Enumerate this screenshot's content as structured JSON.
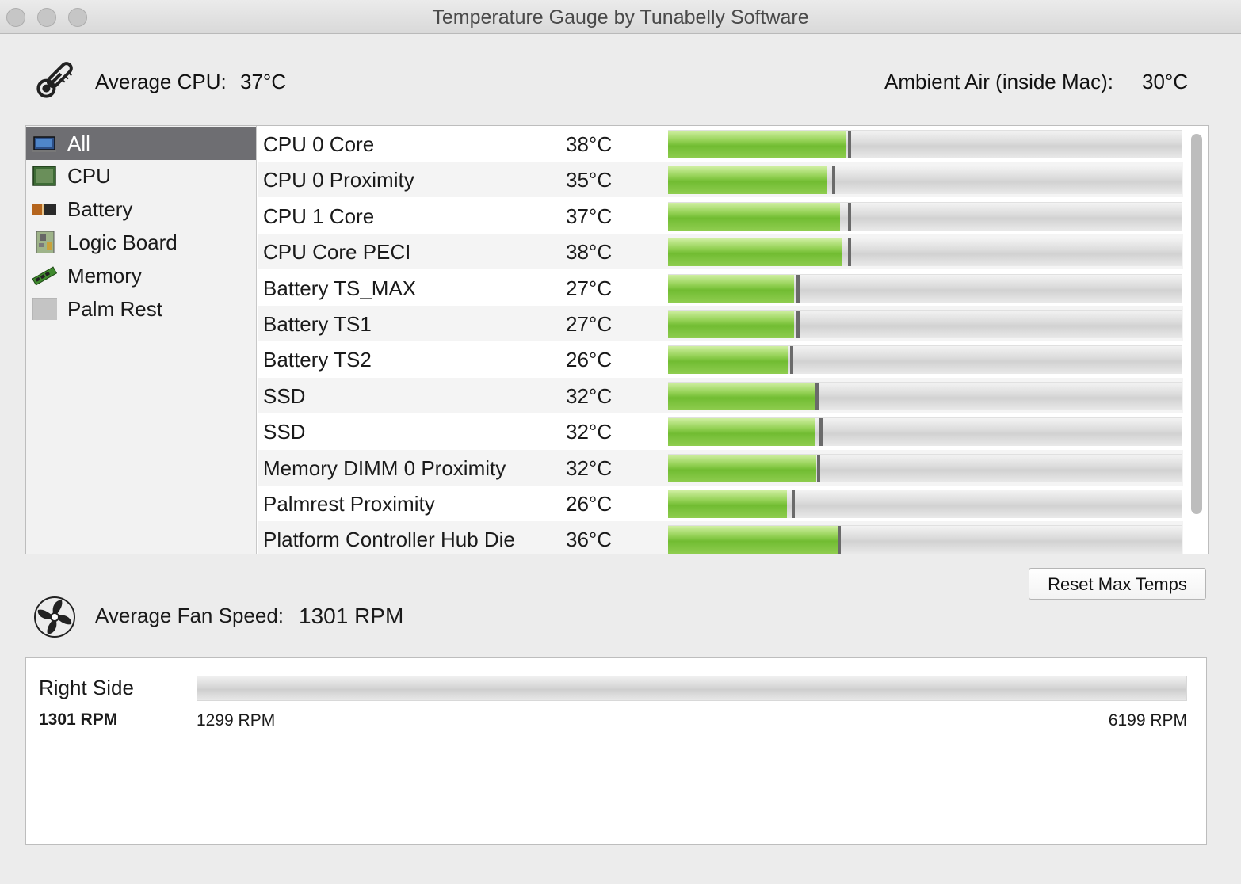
{
  "window": {
    "title": "Temperature Gauge by Tunabelly Software"
  },
  "header": {
    "avg_cpu_label": "Average CPU:",
    "avg_cpu_value": "37°C",
    "ambient_label": "Ambient Air (inside Mac):",
    "ambient_value": "30°C"
  },
  "sidebar": {
    "items": [
      {
        "label": "All",
        "icon": "laptop-icon",
        "selected": true
      },
      {
        "label": "CPU",
        "icon": "cpu-chip-icon"
      },
      {
        "label": "Battery",
        "icon": "battery-icon"
      },
      {
        "label": "Logic Board",
        "icon": "logic-board-icon"
      },
      {
        "label": "Memory",
        "icon": "memory-stick-icon"
      },
      {
        "label": "Palm Rest",
        "icon": "palm-rest-icon"
      }
    ]
  },
  "sensors": [
    {
      "name": "CPU 0 Core",
      "temp": "38°C",
      "level": 0.345,
      "max_level": 0.35
    },
    {
      "name": "CPU 0 Proximity",
      "temp": "35°C",
      "level": 0.31,
      "max_level": 0.32
    },
    {
      "name": "CPU 1 Core",
      "temp": "37°C",
      "level": 0.335,
      "max_level": 0.35
    },
    {
      "name": "CPU Core PECI",
      "temp": "38°C",
      "level": 0.34,
      "max_level": 0.35
    },
    {
      "name": "Battery TS_MAX",
      "temp": "27°C",
      "level": 0.245,
      "max_level": 0.25
    },
    {
      "name": "Battery TS1",
      "temp": "27°C",
      "level": 0.245,
      "max_level": 0.25
    },
    {
      "name": "Battery TS2",
      "temp": "26°C",
      "level": 0.235,
      "max_level": 0.237
    },
    {
      "name": "SSD",
      "temp": "32°C",
      "level": 0.285,
      "max_level": 0.287
    },
    {
      "name": "SSD",
      "temp": "32°C",
      "level": 0.285,
      "max_level": 0.295
    },
    {
      "name": "Memory DIMM 0 Proximity",
      "temp": "32°C",
      "level": 0.288,
      "max_level": 0.29
    },
    {
      "name": "Palmrest Proximity",
      "temp": "26°C",
      "level": 0.232,
      "max_level": 0.24
    },
    {
      "name": "Platform Controller Hub Die",
      "temp": "36°C",
      "level": 0.33,
      "max_level": 0.33
    }
  ],
  "buttons": {
    "reset_max_temps": "Reset Max Temps"
  },
  "fans": {
    "avg_label": "Average Fan Speed:",
    "avg_value": "1301 RPM",
    "items": [
      {
        "name": "Right Side",
        "current": "1301 RPM",
        "min": "1299 RPM",
        "max": "6199 RPM",
        "level": 0.0004
      }
    ]
  },
  "colors": {
    "bar_green": "#7cc43c",
    "selection": "#6e6e72",
    "max_marker": "#6a6a6a"
  }
}
